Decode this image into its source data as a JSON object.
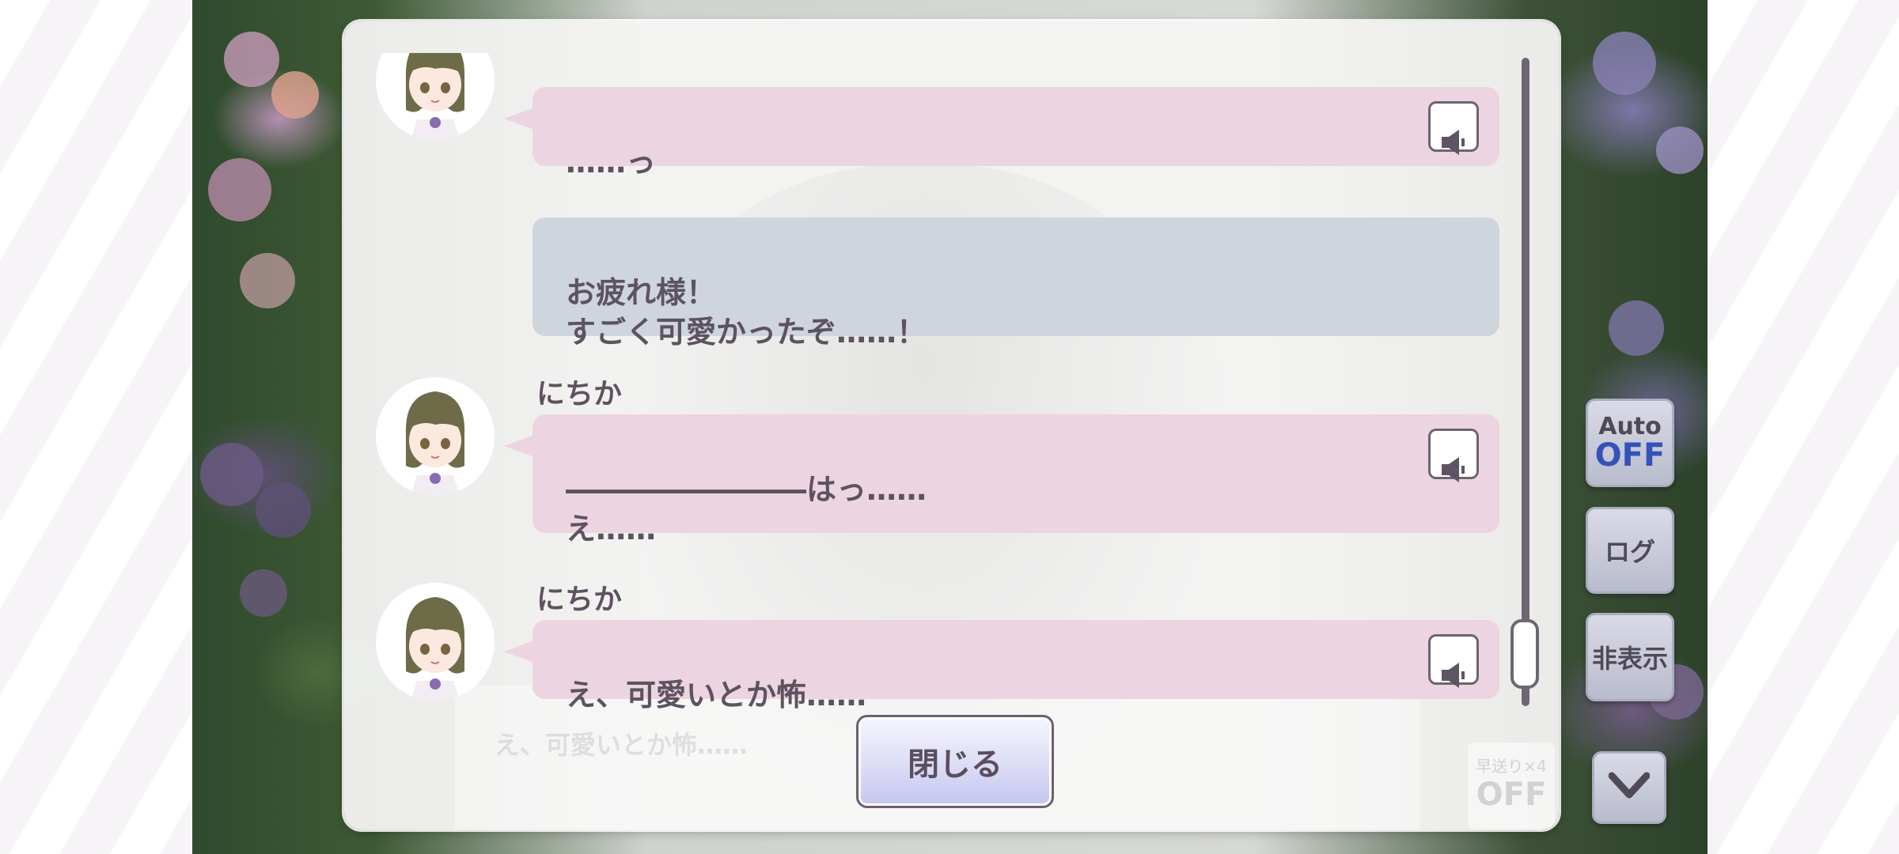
{
  "log": {
    "entries": [
      {
        "speaker": "",
        "side": "npc",
        "text": "……っ",
        "has_voice": true
      },
      {
        "speaker": "",
        "side": "player",
        "text": "お疲れ様！\nすごく可愛かったぞ……！",
        "has_voice": false
      },
      {
        "speaker": "にちか",
        "side": "npc",
        "text": "――――――――はっ……\nえ……",
        "has_voice": true
      },
      {
        "speaker": "にちか",
        "side": "npc",
        "text": "え、可愛いとか怖……",
        "has_voice": true
      }
    ],
    "voice_icon": "speaker-icon",
    "close_label": "閉じる",
    "scroll_position": 1.0
  },
  "background_dialog": {
    "text": "え、可愛いとか怖……",
    "fast_label": "早送り×4",
    "fast_state": "OFF"
  },
  "controls": {
    "auto_label": "Auto",
    "auto_state": "OFF",
    "log_label": "ログ",
    "hide_label": "非表示",
    "menu_icon": "chevron-down-icon"
  },
  "colors": {
    "npc_bubble": "#ecd5e0",
    "player_bubble": "#ced5dd",
    "text": "#5d5360",
    "auto_off": "#3452b8"
  }
}
